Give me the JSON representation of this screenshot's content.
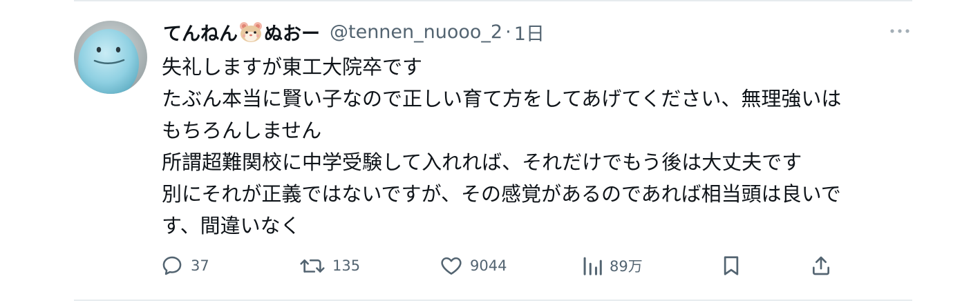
{
  "tweet": {
    "display_name_before": "てんねん",
    "display_name_after": "ぬおー",
    "handle": "@tennen_nuooo_2",
    "separator": "·",
    "time": "1日",
    "body_lines": [
      "失礼しますが東工大院卒です",
      "たぶん本当に賢い子なので正しい育て方をしてあげてください、無理強いは",
      "もちろんしません",
      "所謂超難関校に中学受験して入れれば、それだけでもう後は大丈夫です",
      "別にそれが正義ではないですが、その感覚があるのであれば相当頭は良いで",
      "す、間違いなく"
    ],
    "actions": {
      "replies": "37",
      "retweets": "135",
      "likes": "9044",
      "views": "89万"
    }
  },
  "icons": {
    "avatar": "quagsire-avatar",
    "name_emoji": "hamster-face-icon",
    "more": "more-dots-icon",
    "reply": "reply-icon",
    "retweet": "retweet-icon",
    "like": "heart-icon",
    "views": "views-chart-icon",
    "bookmark": "bookmark-icon",
    "share": "share-icon"
  },
  "colors": {
    "text_primary": "#0f1419",
    "text_secondary": "#536471",
    "divider": "#e6ebee"
  }
}
